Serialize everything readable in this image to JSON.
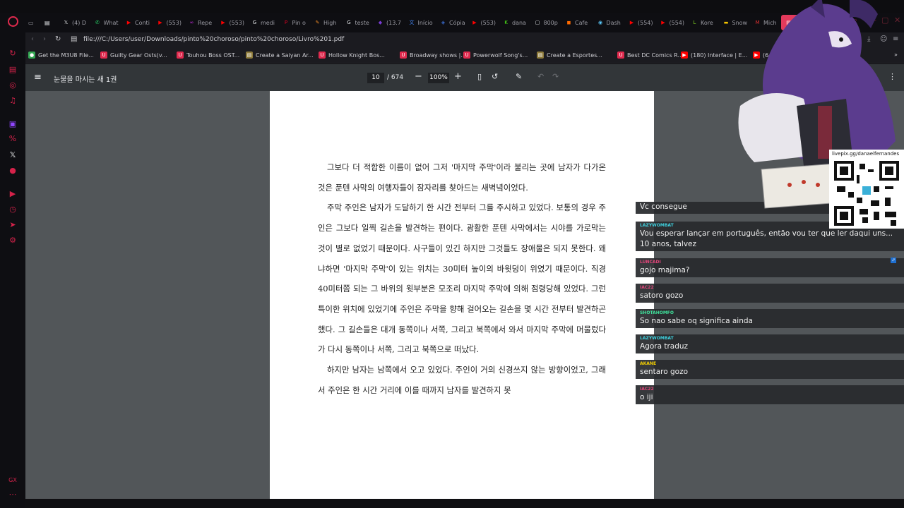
{
  "tabs": [
    {
      "label": "(4) D",
      "icon": "x-icon",
      "color": "#e7e9ea",
      "glyph": "𝕏"
    },
    {
      "label": "What",
      "icon": "whatsapp-icon",
      "color": "#25d366",
      "glyph": "✆"
    },
    {
      "label": "Conti",
      "icon": "youtube-icon",
      "color": "#ff0000",
      "glyph": "▶"
    },
    {
      "label": "(553)",
      "icon": "youtube-icon",
      "color": "#ff0000",
      "glyph": "▶"
    },
    {
      "label": "Repe",
      "icon": "loop-icon",
      "color": "#c62be0",
      "glyph": "∞"
    },
    {
      "label": "(553)",
      "icon": "youtube-icon",
      "color": "#ff0000",
      "glyph": "▶"
    },
    {
      "label": "medi",
      "icon": "google-icon",
      "color": "#e8eaed",
      "glyph": "G"
    },
    {
      "label": "Pin o",
      "icon": "pinterest-icon",
      "color": "#e60023",
      "glyph": "P"
    },
    {
      "label": "High",
      "icon": "pen-icon",
      "color": "#f08a24",
      "glyph": "✎"
    },
    {
      "label": "teste",
      "icon": "google-icon",
      "color": "#e8eaed",
      "glyph": "G"
    },
    {
      "label": "(13.7",
      "icon": "app-icon",
      "color": "#7a3bd6",
      "glyph": "◆"
    },
    {
      "label": "Início",
      "icon": "translate-icon",
      "color": "#4285f4",
      "glyph": "文"
    },
    {
      "label": "Cópia",
      "icon": "shield-icon",
      "color": "#3b6fd6",
      "glyph": "◈"
    },
    {
      "label": "(553)",
      "icon": "youtube-icon",
      "color": "#ff0000",
      "glyph": "▶"
    },
    {
      "label": "dana",
      "icon": "kick-icon",
      "color": "#53fc18",
      "glyph": "K"
    },
    {
      "label": "800p",
      "icon": "file-icon",
      "color": "#e8eaed",
      "glyph": "▢"
    },
    {
      "label": "Cafe",
      "icon": "app-icon",
      "color": "#ff6a00",
      "glyph": "◼"
    },
    {
      "label": "Dash",
      "icon": "dashboard-icon",
      "color": "#5ac8fa",
      "glyph": "◉"
    },
    {
      "label": "(554)",
      "icon": "youtube-icon",
      "color": "#ff0000",
      "glyph": "▶"
    },
    {
      "label": "(554)",
      "icon": "youtube-icon",
      "color": "#ff0000",
      "glyph": "▶"
    },
    {
      "label": "Kore",
      "icon": "lingq-icon",
      "color": "#7ed321",
      "glyph": "L"
    },
    {
      "label": "Snow",
      "icon": "app-icon",
      "color": "#f5c400",
      "glyph": "▬"
    },
    {
      "label": "Mich",
      "icon": "app-icon",
      "color": "#e03030",
      "glyph": "M"
    },
    {
      "label": "눈물을 마시",
      "icon": "pdf-icon",
      "color": "#ffffff",
      "glyph": "▤"
    }
  ],
  "address_bar": {
    "url": "file:///C:/Users/user/Downloads/pinto%20choroso/pinto%20choroso/Livro%201.pdf"
  },
  "bookmarks": [
    {
      "label": "Get the M3U8 File...",
      "icon": "globe-icon",
      "color": "#34a853",
      "glyph": "●"
    },
    {
      "label": "Guilty Gear Osts(v...",
      "icon": "app-icon",
      "color": "#e02a4e",
      "glyph": "U"
    },
    {
      "label": "Touhou Boss OST...",
      "icon": "app-icon",
      "color": "#e02a4e",
      "glyph": "U"
    },
    {
      "label": "Create a Saiyan Ar...",
      "icon": "tier-icon",
      "color": "#8d7a3a",
      "glyph": "▤"
    },
    {
      "label": "Hollow Knight Bos...",
      "icon": "app-icon",
      "color": "#e02a4e",
      "glyph": "U"
    },
    {
      "label": "Broadway shows |...",
      "icon": "app-icon",
      "color": "#e02a4e",
      "glyph": "U"
    },
    {
      "label": "Powerwolf Song's...",
      "icon": "app-icon",
      "color": "#e02a4e",
      "glyph": "U"
    },
    {
      "label": "Create a Esportes...",
      "icon": "tier-icon",
      "color": "#8d7a3a",
      "glyph": "▤"
    },
    {
      "label": "Best DC Comics R...",
      "icon": "app-icon",
      "color": "#e02a4e",
      "glyph": "U"
    },
    {
      "label": "(180) Interface | E...",
      "icon": "youtube-icon",
      "color": "#ff0000",
      "glyph": "▶"
    },
    {
      "label": "(647)",
      "icon": "youtube-icon",
      "color": "#ff0000",
      "glyph": "▶"
    }
  ],
  "pdf": {
    "title": "눈물을 마시는 새 1권",
    "current_page": "10",
    "total_pages": "/ 674",
    "zoom": "100%",
    "paragraphs": [
      "그보다 더 적합한 이름이 없어 그저 '마지막 주막'이라 불리는 곳에 남자가 다가온 것은 푼텐 사막의 여행자들이 잠자리를 찾아드는 새벽녘이었다.",
      "주막 주인은 남자가 도달하기 한 시간 전부터 그를 주시하고 있었다. 보통의 경우 주인은 그보다 일찍 길손을 발견하는 편이다. 광활한 푼텐 사막에서는 시야를 가로막는 것이 별로 없었기 때문이다. 사구들이 있긴 하지만 그것들도 장애물은 되지 못한다. 왜냐하면 '마지막 주막'이 있는 위치는 30미터 높이의 바윗덩이 위였기 때문이다. 직경 40미터쯤 되는 그 바위의 윗부분은 모조리 마지막 주막에 의해 점령당해 있었다. 그런 특이한 위치에 있었기에 주인은 주막을 향해 걸어오는 길손을 몇 시간 전부터 발견하곤 했다. 그 길손들은 대개 동쪽이나 서쪽, 그리고 북쪽에서 와서 마지막 주막에 머물렀다가 다시 동쪽이나 서쪽, 그리고 북쪽으로 떠났다.",
      "하지만 남자는 남쪽에서 오고 있었다. 주인이 거의 신경쓰지 않는 방향이었고, 그래서 주인은 한 시간 거리에 이를 때까지 남자를 발견하지 못"
    ]
  },
  "chat": {
    "messages": [
      {
        "user": "",
        "user_color": "#ffffff",
        "text": "Vc consegue"
      },
      {
        "user": "LAZYWOMBAT",
        "user_color": "#3fd2e0",
        "text": "Vou esperar lançar em português, então vou ter que ler daqui uns... 10 anos, talvez"
      },
      {
        "user": "LUNCADI",
        "user_color": "#e0457a",
        "text": "gojo majima?"
      },
      {
        "user": "IAC22",
        "user_color": "#e0457a",
        "text": "satoro gozo"
      },
      {
        "user": "SHOTAHOMFO",
        "user_color": "#3fe09a",
        "text": "So nao sabe oq significa ainda"
      },
      {
        "user": "LAZYWOMBAT",
        "user_color": "#3fd2e0",
        "text": "Agora traduz"
      },
      {
        "user": "AKANE",
        "user_color": "#f5d000",
        "text": "sentaro gozo"
      },
      {
        "user": "IAC22",
        "user_color": "#e0457a",
        "text": "o iji"
      }
    ]
  },
  "overlay": {
    "qr_url": "livepix.gg/danaelfernandes"
  },
  "colors": {
    "accent": "#e33a5c",
    "pdf_toolbar": "#323639",
    "viewer_bg": "#525659"
  }
}
